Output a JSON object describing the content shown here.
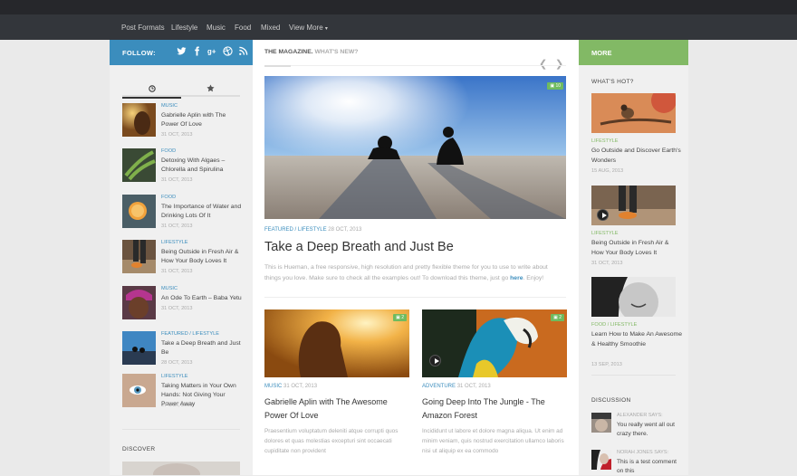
{
  "nav": {
    "items": [
      "Post Formats",
      "Lifestyle",
      "Music",
      "Food",
      "Mixed",
      "View More"
    ],
    "more_caret": "▾"
  },
  "left": {
    "follow": "FOLLOW:",
    "social": [
      "twitter-icon",
      "facebook-icon",
      "google-plus-icon",
      "dribbble-icon",
      "rss-icon"
    ],
    "tabs": [
      "clock-icon",
      "star-icon"
    ],
    "posts": [
      {
        "cat": "MUSIC",
        "title": "Gabrielle Aplin with The Power Of Love",
        "date": "31 OCT, 2013"
      },
      {
        "cat": "FOOD",
        "title": "Detoxing With Algaes – Chlorella and Spirulina",
        "date": "31 OCT, 2013"
      },
      {
        "cat": "FOOD",
        "title": "The Importance of Water and Drinking Lots Of It",
        "date": "31 OCT, 2013"
      },
      {
        "cat": "LIFESTYLE",
        "title": "Being Outside in Fresh Air & How Your Body Loves It",
        "date": "31 OCT, 2013"
      },
      {
        "cat": "MUSIC",
        "title": "An Ode To Earth – Baba Yetu",
        "date": "31 OCT, 2013"
      },
      {
        "cat": "FEATURED / LIFESTYLE",
        "title": "Take a Deep Breath and Just Be",
        "date": "28 OCT, 2013"
      },
      {
        "cat": "LIFESTYLE",
        "title": "Taking Matters in Your Own Hands: Not Giving Your Power Away",
        "date": "27 OCT, 2013"
      }
    ],
    "discover": "DISCOVER"
  },
  "main": {
    "heading": "THE MAGAZINE.",
    "subheading": "WHAT'S NEW?",
    "featured": {
      "comments": "10",
      "cat1": "FEATURED",
      "slash": " / ",
      "cat2": "LIFESTYLE",
      "date": "28 OCT, 2013",
      "title": "Take a Deep Breath and Just Be",
      "excerpt": "This is Hueman, a free responsive, high resolution and pretty flexible theme for you to use to write about things you love. Make sure to check all the examples out! To download this theme, just go",
      "link": "here",
      "excerpt_end": ". Enjoy!"
    },
    "cards": [
      {
        "comments": "2",
        "cat": "MUSIC",
        "date": "31 OCT, 2013",
        "title": "Gabrielle Aplin with The Awesome Power Of Love",
        "excerpt": "Praesentium voluptatum deleniti atque corrupti quos dolores et quas molestias excepturi sint occaecati cupiditate non provident"
      },
      {
        "comments": "2",
        "cat": "ADVENTURE",
        "date": "31 OCT, 2013",
        "title": "Going Deep Into The Jungle - The Amazon Forest",
        "excerpt": "Incididunt ut labore et dolore magna aliqua. Ut enim ad minim veniam, quis nostrud exercitation ullamco laboris nisi ut aliquip ex ea commodo"
      }
    ]
  },
  "right": {
    "more": "MORE",
    "hot": "WHAT'S HOT?",
    "posts": [
      {
        "cat": "LIFESTYLE",
        "title": "Go Outside and Discover Earth's Wonders",
        "date": "15 AUG, 2013"
      },
      {
        "cat": "LIFESTYLE",
        "title": "Being Outside in Fresh Air & How Your Body Loves It",
        "date": "31 OCT, 2013"
      },
      {
        "cat": "FOOD / LIFESTYLE",
        "title": "Learn How to Make An Awesome & Healthy Smoothie",
        "date": "13 SEP, 2013"
      }
    ],
    "discussion": "DISCUSSION",
    "comments": [
      {
        "who": "ALEXANDER SAYS:",
        "text": "You really went all out crazy there."
      },
      {
        "who": "NORAH JONES SAYS:",
        "text": "This is a test comment on this"
      }
    ]
  }
}
